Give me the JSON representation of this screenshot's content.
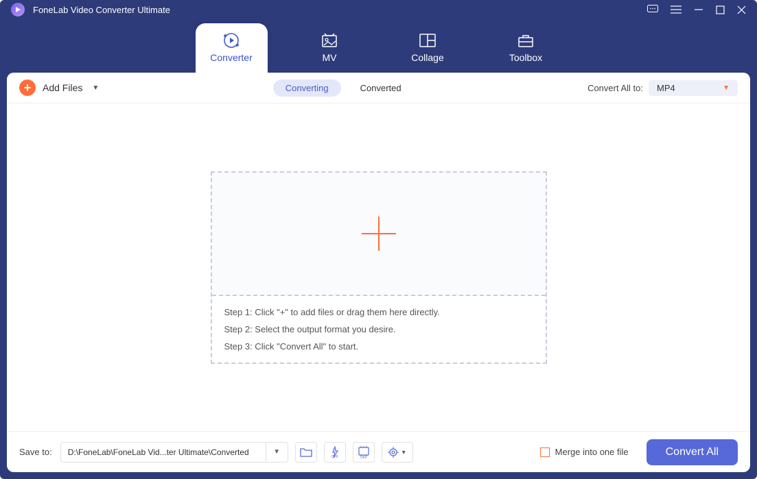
{
  "title": "FoneLab Video Converter Ultimate",
  "tabs": [
    {
      "label": "Converter"
    },
    {
      "label": "MV"
    },
    {
      "label": "Collage"
    },
    {
      "label": "Toolbox"
    }
  ],
  "toolbar": {
    "add_files_label": "Add Files",
    "converting_label": "Converting",
    "converted_label": "Converted",
    "convert_all_to_label": "Convert All to:",
    "format_value": "MP4"
  },
  "dropzone": {
    "step1": "Step 1: Click \"+\" to add files or drag them here directly.",
    "step2": "Step 2: Select the output format you desire.",
    "step3": "Step 3: Click \"Convert All\" to start."
  },
  "bottom": {
    "save_to_label": "Save to:",
    "path_value": "D:\\FoneLab\\FoneLab Vid...ter Ultimate\\Converted",
    "merge_label": "Merge into one file",
    "convert_all_label": "Convert All"
  }
}
